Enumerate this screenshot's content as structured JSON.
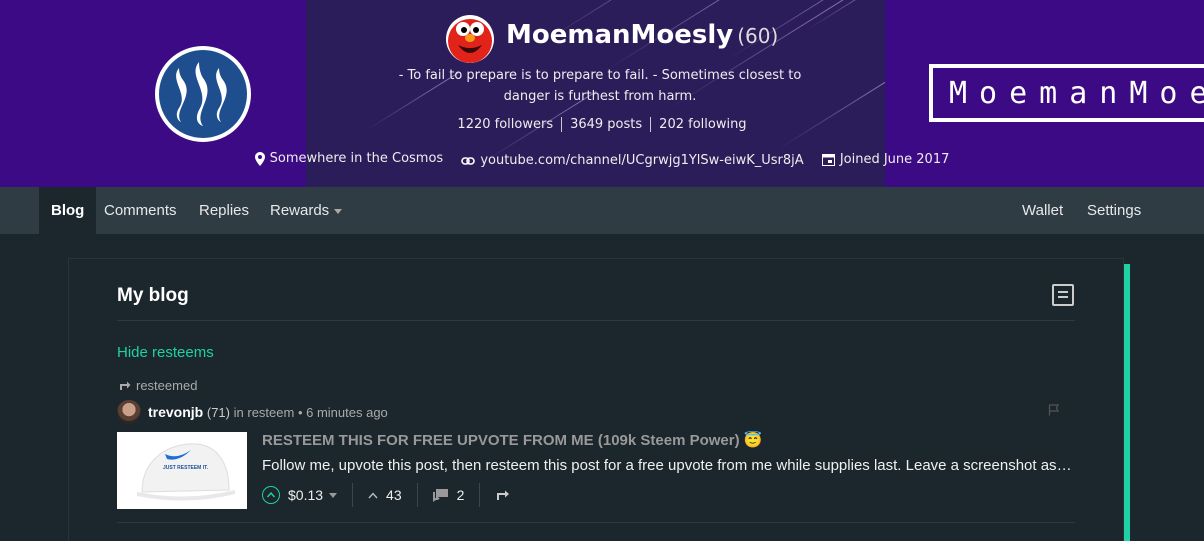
{
  "profile": {
    "name": "MoemanMoesly",
    "reputation": "(60)",
    "about_line1": "- To fail to prepare is to prepare to fail. - Sometimes closest to",
    "about_line2": "danger is furthest from harm.",
    "followers": "1220 followers",
    "posts": "3649 posts",
    "following": "202 following",
    "location": "Somewhere in the Cosmos",
    "website": "youtube.com/channel/UCgrwjg1YlSw-eiwK_Usr8jA",
    "joined": "Joined June 2017",
    "banner_text": "MoemanMoesl"
  },
  "nav": {
    "blog": "Blog",
    "comments": "Comments",
    "replies": "Replies",
    "rewards": "Rewards",
    "wallet": "Wallet",
    "settings": "Settings"
  },
  "blog": {
    "title": "My blog",
    "hide_resteems": "Hide resteems"
  },
  "post": {
    "resteemed_label": "resteemed",
    "author": "trevonjb",
    "author_rep": "(71)",
    "in_label": "in",
    "community": "resteem",
    "time": "• 6 minutes ago",
    "title": "RESTEEM THIS FOR FREE UPVOTE FROM ME (109k Steem Power) 😇",
    "body": "Follow me, upvote this post, then resteem this post for a free upvote from me while supplies last. Leave a screenshot as proof in the comments below.",
    "payout": "$0.13",
    "votes": "43",
    "comments": "2",
    "thumb_text": "JUST RESTEEM IT."
  },
  "colors": {
    "accent": "#1fd1a5",
    "banner": "#3d0a85",
    "background": "#1b262d",
    "nav": "#2f3c44"
  }
}
